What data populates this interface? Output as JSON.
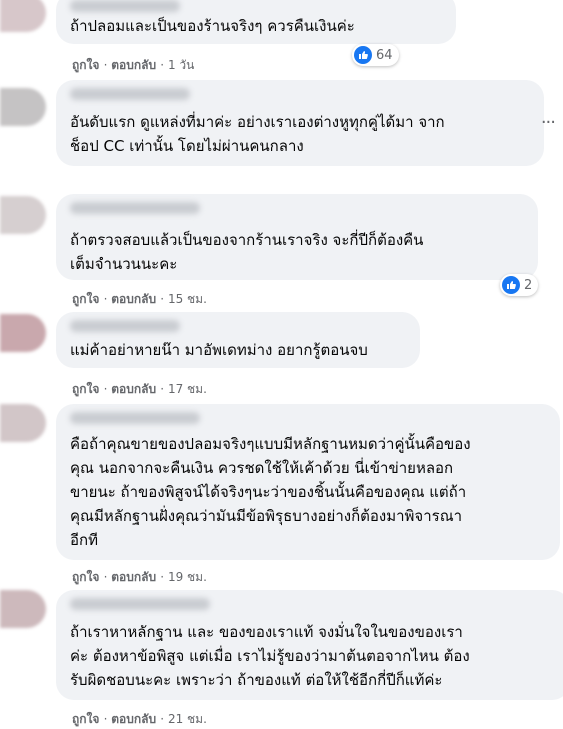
{
  "comments": [
    {
      "text": "ถ้าปลอมและเป็นของร้านจริงๆ ควรคืนเงินค่ะ",
      "like": "ถูกใจ",
      "reply": "ตอบกลับ",
      "time": "1 วัน",
      "reactions": "64"
    },
    {
      "text": "อันดับแรก ดูแหล่งที่มาค่ะ อย่างเราเองต่างหูทุกคู่ได้มา จาก\nช็อป CC เท่านั้น โดยไม่ผ่านคนกลาง",
      "more": "···"
    },
    {
      "text": "ถ้าตรวจสอบแล้วเป็นของจากร้านเราจริง จะกี่ปีก็ต้องคืน\nเต็มจำนวนนะคะ",
      "like": "ถูกใจ",
      "reply": "ตอบกลับ",
      "time": "15 ชม.",
      "reactions": "2"
    },
    {
      "text": "แม่ค้าอย่าหายน๊า มาอัพเดทม่าง อยากรู้ตอนจบ",
      "like": "ถูกใจ",
      "reply": "ตอบกลับ",
      "time": "17 ชม."
    },
    {
      "text": "คือถ้าคุณขายของปลอมจริงๆแบบมีหลักฐานหมดว่าคู่นั้นคือของ\nคุณ นอกจากจะคืนเงิน ควรชดใช้ให้เค้าด้วย นี่เข้าข่ายหลอก\nขายนะ ถ้าของพิสูจน์ได้จริงๆนะว่าของชิ้นนั้นคือของคุณ แต่ถ้า\nคุณมีหลักฐานฝั่งคุณว่ามันมีข้อพิรุธบางอย่างก็ต้องมาพิจารณา\nอีกที",
      "like": "ถูกใจ",
      "reply": "ตอบกลับ",
      "time": "19 ชม."
    },
    {
      "text": "ถ้าเราหาหลักฐาน และ ของของเราแท้ จงมั่นใจในของของเรา\nค่ะ ต้องหาข้อพิสูจ แต่เมื่อ เราไม่รู้ของว่ามาต้นตอจากไหน ต้อง\nรับผิดชอบนะคะ เพราะว่า ถ้าของแท้ ต่อให้ใช้อีกกี่ปีก็แท้ค่ะ",
      "like": "ถูกใจ",
      "reply": "ตอบกลับ",
      "time": "21 ชม."
    }
  ],
  "separator": "·",
  "colors": {
    "bubble": "#f0f2f5",
    "meta": "#65676b",
    "like": "#1877f2"
  }
}
